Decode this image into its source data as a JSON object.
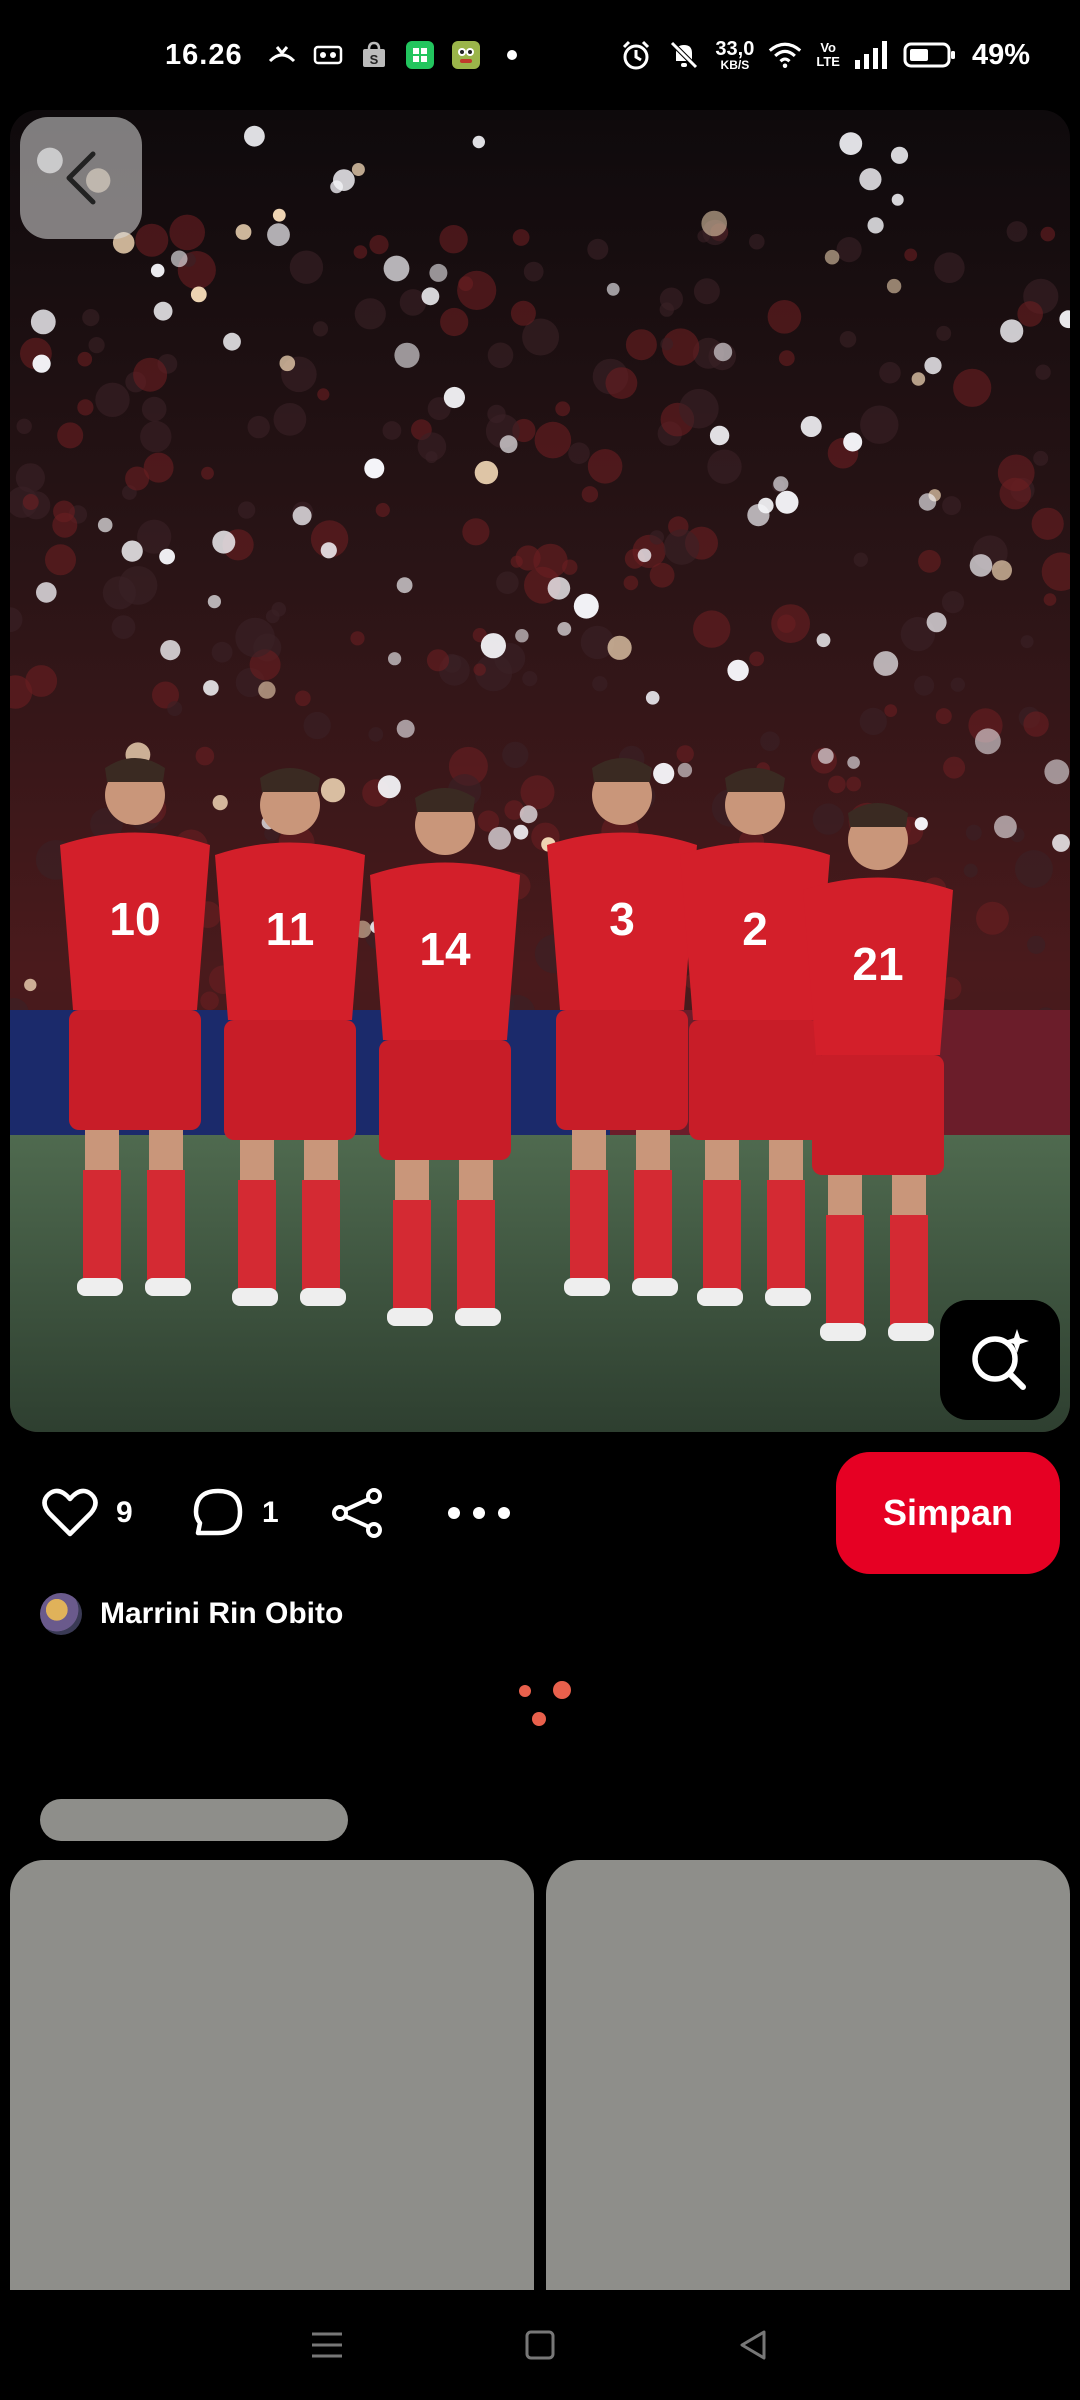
{
  "status_bar": {
    "time": "16.26",
    "net_speed_value": "33,0",
    "net_speed_unit": "KB/S",
    "volte_top": "Vo",
    "volte_bottom": "LTE",
    "battery_percent": "49%"
  },
  "pin": {
    "image_icon": "photo-stadium-team",
    "back_icon": "chevron-left-icon",
    "lens_icon": "visual-search-icon"
  },
  "actions": {
    "like_count": "9",
    "comment_count": "1",
    "save_label": "Simpan"
  },
  "author": {
    "name": "Marrini Rin Obito"
  },
  "colors": {
    "save_button": "#e60023",
    "loader": "#e8604c",
    "skeleton": "#8e8e8a"
  },
  "jersey_numbers": [
    "10",
    "11",
    "14",
    "3",
    "2",
    "21"
  ]
}
